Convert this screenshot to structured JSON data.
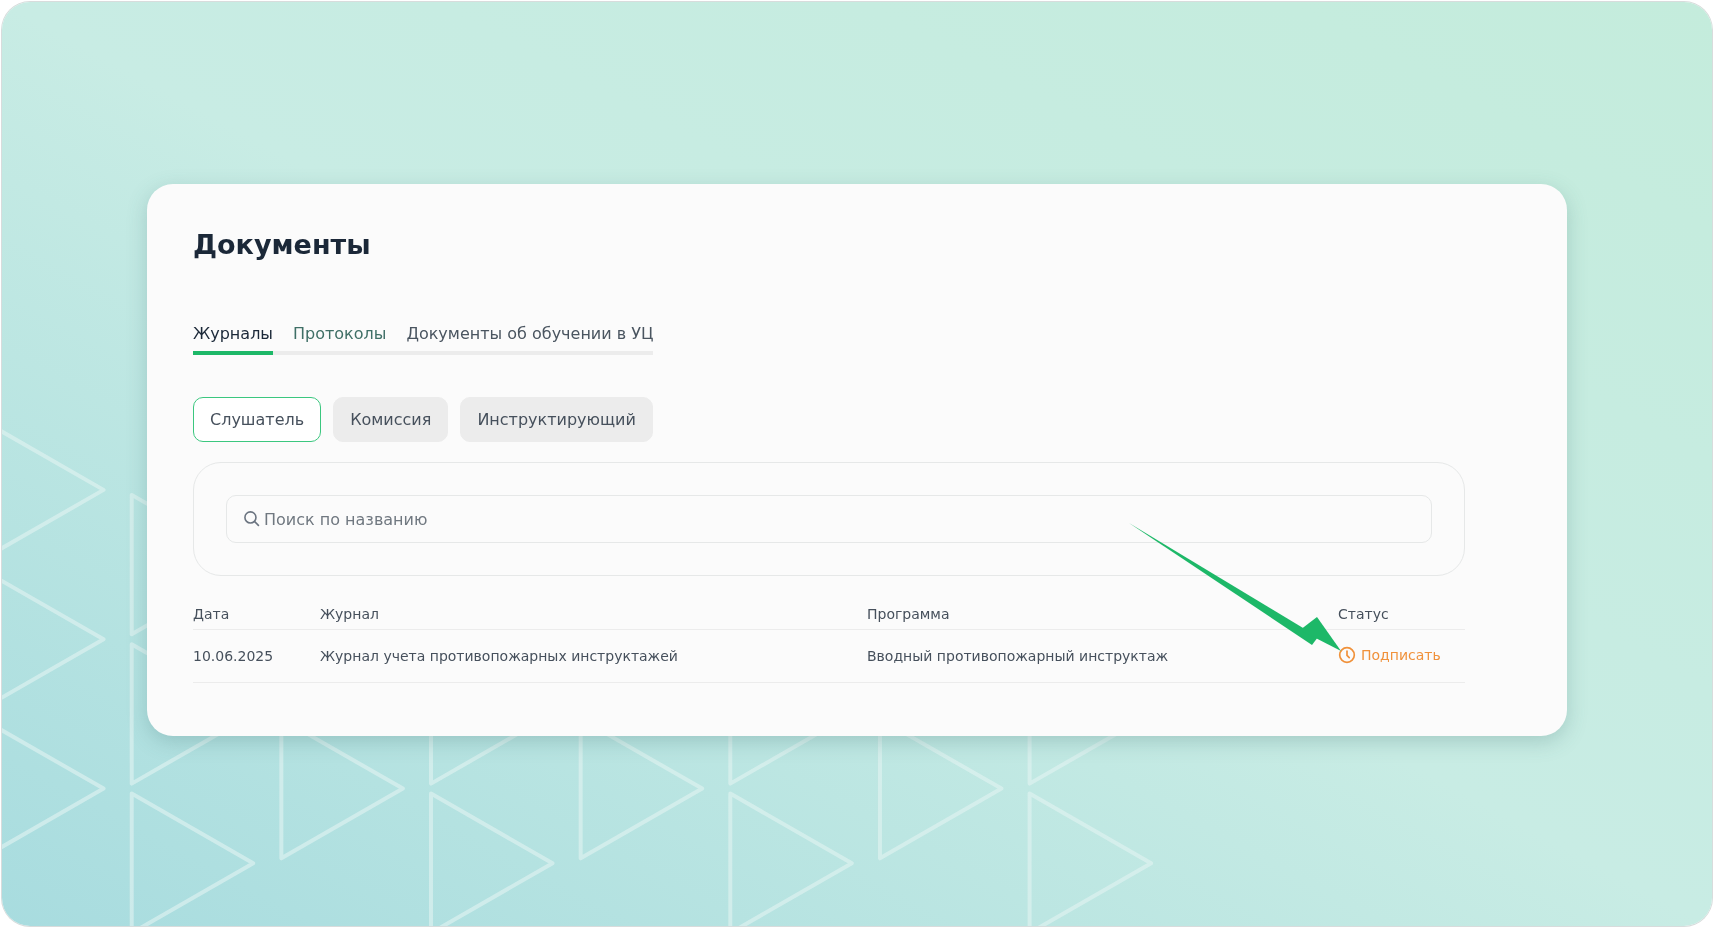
{
  "page": {
    "title": "Документы"
  },
  "tabs": [
    {
      "label": "Журналы",
      "selected": true
    },
    {
      "label": "Протоколы",
      "selected": false
    },
    {
      "label": "Документы об обучении в УЦ",
      "selected": false
    }
  ],
  "filters": [
    {
      "label": "Слушатель",
      "selected": true
    },
    {
      "label": "Комиссия",
      "selected": false
    },
    {
      "label": "Инструктирующий",
      "selected": false
    }
  ],
  "search": {
    "placeholder": "Поиск по названию"
  },
  "table": {
    "columns": [
      "Дата",
      "Журнал",
      "Программа",
      "Статус"
    ],
    "rows": [
      {
        "date": "10.06.2025",
        "journal": "Журнал учета противопожарных инструктажей",
        "program": "Вводный противопожарный инструктаж",
        "status": {
          "kind": "pending",
          "label": "Подписать"
        }
      }
    ]
  },
  "annotation": {
    "kind": "arrow"
  }
}
